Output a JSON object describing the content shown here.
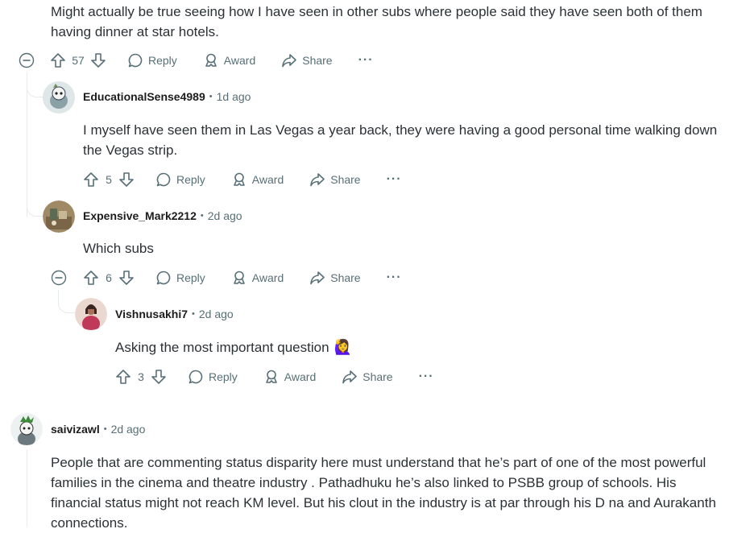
{
  "comment_top": {
    "line1": "Might actually be true seeing how I have seen in other subs where people said they have seen both of them",
    "line2": "having dinner at star hotels.",
    "votes": "57"
  },
  "comment_c1": {
    "username": "EducationalSense4989",
    "time": "1d ago",
    "line1": "I myself have seen them in Las Vegas a year back, they were having a good personal time walking down",
    "line2": "the Vegas strip.",
    "votes": "5"
  },
  "comment_c2": {
    "username": "Expensive_Mark2212",
    "time": "2d ago",
    "line1": "Which subs",
    "votes": "6"
  },
  "comment_c3": {
    "username": "Vishnusakhi7",
    "time": "2d ago",
    "line1": "Asking the most important question",
    "emoji": "🙋‍♀️",
    "votes": "3"
  },
  "comment_c4": {
    "username": "saivizawl",
    "time": "2d ago",
    "line1": "People that are commenting status disparity here must understand that he’s part of one of the most powerful",
    "line2": "families in the cinema and theatre industry . Pathadhuku he’s also linked to PSBB group of schools. His",
    "line3": "financial status might not reach KM level. But his clout in the industry is at par through his D na and Aurakanth",
    "line4": "connections."
  },
  "labels": {
    "reply": "Reply",
    "award": "Award",
    "share": "Share",
    "more": "···",
    "sep": "•"
  },
  "icons": [
    "collapse-icon",
    "upvote-icon",
    "downvote-icon",
    "comment-icon",
    "award-icon",
    "share-icon",
    "more-icon"
  ]
}
